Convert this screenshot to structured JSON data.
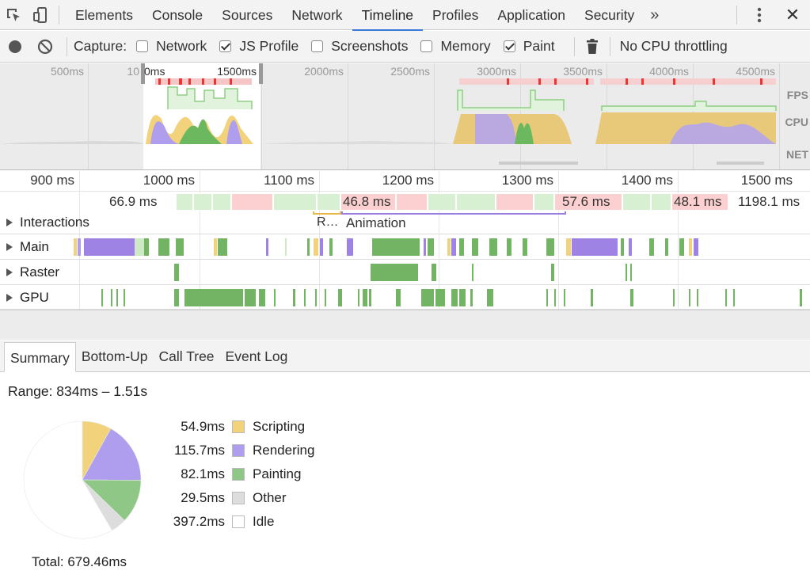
{
  "tabs": [
    "Elements",
    "Console",
    "Sources",
    "Network",
    "Timeline",
    "Profiles",
    "Application",
    "Security"
  ],
  "active_tab": "Timeline",
  "more_tabs": "»",
  "close_label": "✕",
  "toolbar": {
    "capture_label": "Capture:",
    "checkboxes": [
      {
        "label": "Network",
        "checked": false
      },
      {
        "label": "JS Profile",
        "checked": true
      },
      {
        "label": "Screenshots",
        "checked": false
      },
      {
        "label": "Memory",
        "checked": false
      },
      {
        "label": "Paint",
        "checked": true
      }
    ],
    "throttling": "No CPU throttling"
  },
  "overview": {
    "ticks": [
      "500ms",
      "10",
      "0ms",
      "1500ms",
      "2000ms",
      "2500ms",
      "3000ms",
      "3500ms",
      "4000ms",
      "4500ms"
    ],
    "side_labels": [
      "FPS",
      "CPU",
      "NET"
    ]
  },
  "ruler": {
    "ticks": [
      "900 ms",
      "1000 ms",
      "1100 ms",
      "1200 ms",
      "1300 ms",
      "1400 ms",
      "1500 ms"
    ]
  },
  "frames": {
    "labels": [
      "66.9 ms",
      "46.8 ms",
      "57.6 ms",
      "48.1 ms",
      "1198.1 ms"
    ]
  },
  "interactions": {
    "label": "Interactions",
    "items": [
      "R…",
      "Animation"
    ]
  },
  "tracks": [
    "Main",
    "Raster",
    "GPU"
  ],
  "subtabs": [
    "Summary",
    "Bottom-Up",
    "Call Tree",
    "Event Log"
  ],
  "active_subtab": "Summary",
  "summary": {
    "range": "Range: 834ms – 1.51s",
    "total": "Total: 679.46ms",
    "items": [
      {
        "value": "54.9ms",
        "name": "Scripting",
        "color": "#f2d37b"
      },
      {
        "value": "115.7ms",
        "name": "Rendering",
        "color": "#af9ded"
      },
      {
        "value": "82.1ms",
        "name": "Painting",
        "color": "#8fc886"
      },
      {
        "value": "29.5ms",
        "name": "Other",
        "color": "#dddddd"
      },
      {
        "value": "397.2ms",
        "name": "Idle",
        "color": "#ffffff"
      }
    ]
  },
  "colors": {
    "scripting": "#f2d37b",
    "rendering": "#af9ded",
    "painting": "#8fc886",
    "paint_track": "#72b463",
    "accent": "#3879d9"
  }
}
